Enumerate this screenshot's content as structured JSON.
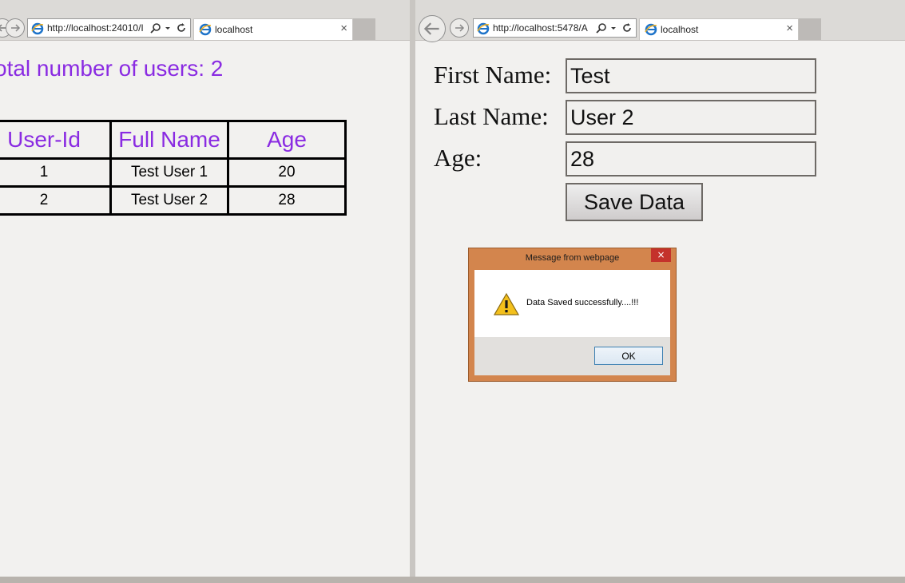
{
  "left_browser": {
    "address_url": "http://localhost:24010/I",
    "tab_title": "localhost",
    "tab_close": "×",
    "page": {
      "heading": "otal number of users: 2",
      "table": {
        "headers": [
          "User-Id",
          "Full Name",
          "Age"
        ],
        "rows": [
          [
            "1",
            "Test User 1",
            "20"
          ],
          [
            "2",
            "Test User 2",
            "28"
          ]
        ]
      }
    }
  },
  "right_browser": {
    "address_url": "http://localhost:5478/A",
    "tab_title": "localhost",
    "tab_close": "×",
    "form": {
      "first_name_label": "First Name:",
      "first_name_value": "Test",
      "last_name_label": "Last Name:",
      "last_name_value": "User 2",
      "age_label": "Age:",
      "age_value": "28",
      "save_label": "Save Data"
    },
    "dialog": {
      "title": "Message from webpage",
      "close": "×",
      "message": "Data Saved successfully....!!!",
      "ok_label": "OK"
    }
  },
  "icons": {
    "back": "arrow-left-icon",
    "forward": "arrow-right-icon",
    "browser": "internet-explorer-icon",
    "search": "search-icon",
    "dropdown": "chevron-down-icon",
    "refresh": "refresh-icon",
    "warning": "warning-icon"
  },
  "colors": {
    "heading": "#8a2be2",
    "dialog_frame": "#d3854d",
    "dialog_close": "#c4322b"
  }
}
